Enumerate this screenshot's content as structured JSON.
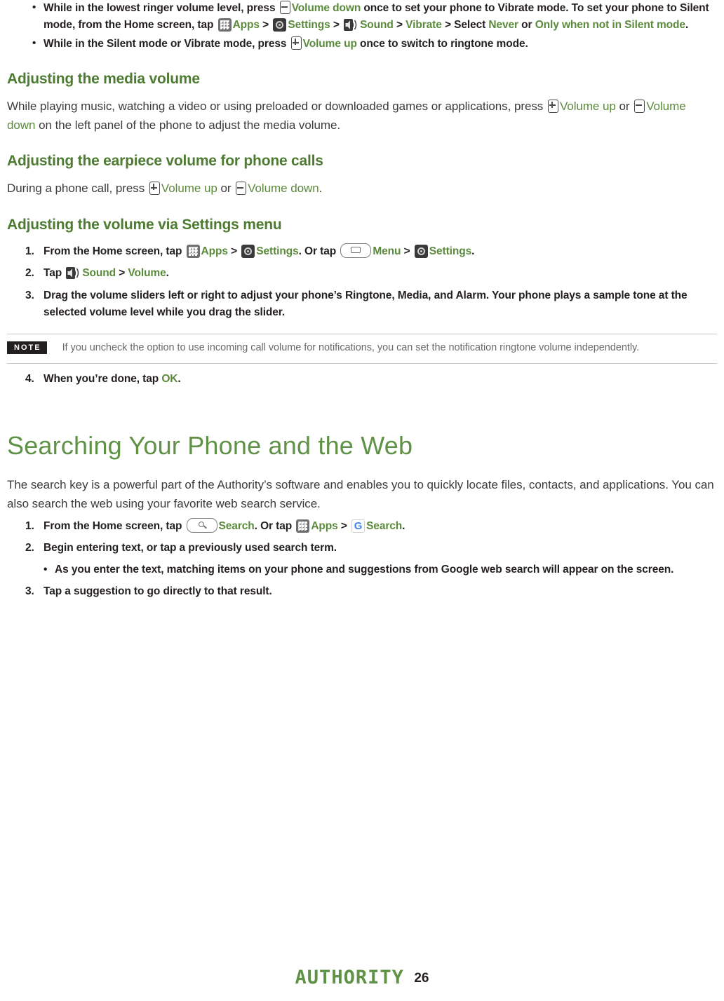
{
  "top_bullets": [
    {
      "parts": [
        {
          "t": "text",
          "v": "While in the lowest ringer volume level, press "
        },
        {
          "t": "icon",
          "v": "volume-down-key-icon"
        },
        {
          "t": "green",
          "v": "Volume down"
        },
        {
          "t": "text",
          "v": " once to set your phone to Vibrate mode. To set your phone to Silent mode, from the Home screen, tap "
        },
        {
          "t": "icon",
          "v": "apps-icon"
        },
        {
          "t": "green",
          "v": "Apps"
        },
        {
          "t": "text",
          "v": " > "
        },
        {
          "t": "icon",
          "v": "settings-icon"
        },
        {
          "t": "green",
          "v": "Settings"
        },
        {
          "t": "text",
          "v": " > "
        },
        {
          "t": "icon",
          "v": "sound-icon"
        },
        {
          "t": "green",
          "v": "Sound"
        },
        {
          "t": "text",
          "v": " > "
        },
        {
          "t": "green",
          "v": "Vibrate"
        },
        {
          "t": "text",
          "v": " > Select "
        },
        {
          "t": "green",
          "v": "Never"
        },
        {
          "t": "text",
          "v": " or "
        },
        {
          "t": "green",
          "v": "Only when not in Silent mode"
        },
        {
          "t": "text",
          "v": "."
        }
      ]
    },
    {
      "parts": [
        {
          "t": "text",
          "v": "While in the Silent mode or Vibrate mode, press "
        },
        {
          "t": "icon",
          "v": "volume-up-key-icon"
        },
        {
          "t": "green",
          "v": "Volume up"
        },
        {
          "t": "text",
          "v": " once to switch to ringtone mode."
        }
      ]
    }
  ],
  "media_volume": {
    "heading": "Adjusting the media volume",
    "parts": [
      {
        "t": "text",
        "v": "While playing music, watching a video or using preloaded or downloaded games or applications, press "
      },
      {
        "t": "icon",
        "v": "volume-up-key-icon"
      },
      {
        "t": "green",
        "v": "Volume up"
      },
      {
        "t": "text",
        "v": " or "
      },
      {
        "t": "icon",
        "v": "volume-down-key-icon"
      },
      {
        "t": "green",
        "v": "Volume down"
      },
      {
        "t": "text",
        "v": " on the left panel of the phone to adjust the media volume."
      }
    ]
  },
  "earpiece_volume": {
    "heading": "Adjusting the earpiece volume for phone calls",
    "parts": [
      {
        "t": "text",
        "v": "During a phone call, press "
      },
      {
        "t": "icon",
        "v": "volume-up-key-icon"
      },
      {
        "t": "green",
        "v": "Volume up"
      },
      {
        "t": "text",
        "v": " or "
      },
      {
        "t": "icon",
        "v": "volume-down-key-icon"
      },
      {
        "t": "green",
        "v": "Volume down"
      },
      {
        "t": "text",
        "v": "."
      }
    ]
  },
  "settings_volume": {
    "heading": "Adjusting the volume via Settings menu",
    "steps": [
      {
        "num": "1.",
        "parts": [
          {
            "t": "text",
            "v": "From the Home screen, tap "
          },
          {
            "t": "icon",
            "v": "apps-icon"
          },
          {
            "t": "green",
            "v": "Apps"
          },
          {
            "t": "text",
            "v": " > "
          },
          {
            "t": "icon",
            "v": "settings-icon"
          },
          {
            "t": "green",
            "v": "Settings"
          },
          {
            "t": "text",
            "v": ". Or tap "
          },
          {
            "t": "icon",
            "v": "menu-key-icon"
          },
          {
            "t": "green",
            "v": "Menu"
          },
          {
            "t": "text",
            "v": " > "
          },
          {
            "t": "icon",
            "v": "settings-icon"
          },
          {
            "t": "green",
            "v": "Settings"
          },
          {
            "t": "text",
            "v": "."
          }
        ]
      },
      {
        "num": "2.",
        "parts": [
          {
            "t": "text",
            "v": "Tap "
          },
          {
            "t": "icon",
            "v": "sound-icon"
          },
          {
            "t": "green",
            "v": "Sound"
          },
          {
            "t": "text",
            "v": " > "
          },
          {
            "t": "green",
            "v": "Volume"
          },
          {
            "t": "text",
            "v": "."
          }
        ]
      },
      {
        "num": "3.",
        "parts": [
          {
            "t": "text",
            "v": "Drag the volume sliders left or right to adjust your phone’s Ringtone, Media, and Alarm. Your phone plays a sample tone at the selected volume level while you drag the slider."
          }
        ]
      }
    ],
    "note": {
      "badge": "NOTE",
      "text": "If you uncheck the option to use incoming call volume for notifications, you can set the notification ringtone volume independently."
    },
    "final_step": {
      "num": "4.",
      "parts": [
        {
          "t": "text",
          "v": "When you’re done, tap "
        },
        {
          "t": "green",
          "v": "OK"
        },
        {
          "t": "text",
          "v": "."
        }
      ]
    }
  },
  "search_chapter": {
    "title": "Searching Your Phone and the Web",
    "intro": "The search key is a powerful part of the Authority’s software and enables you to quickly locate files, contacts, and applications. You can also search the web using your favorite web search service.",
    "steps": [
      {
        "num": "1.",
        "parts": [
          {
            "t": "text",
            "v": "From the Home screen, tap "
          },
          {
            "t": "icon",
            "v": "search-key-icon"
          },
          {
            "t": "green",
            "v": "Search"
          },
          {
            "t": "text",
            "v": ". Or tap "
          },
          {
            "t": "icon",
            "v": "apps-icon"
          },
          {
            "t": "green",
            "v": "Apps"
          },
          {
            "t": "text",
            "v": " > "
          },
          {
            "t": "icon",
            "v": "google-search-icon"
          },
          {
            "t": "green",
            "v": "Search"
          },
          {
            "t": "text",
            "v": "."
          }
        ]
      },
      {
        "num": "2.",
        "parts": [
          {
            "t": "text",
            "v": "Begin entering text, or tap a previously used search term."
          }
        ]
      }
    ],
    "substep": "As you enter the text, matching items on your phone and suggestions from Google web search will appear on the screen.",
    "last_step": {
      "num": "3.",
      "parts": [
        {
          "t": "text",
          "v": "Tap a suggestion to go directly to that result."
        }
      ]
    }
  },
  "footer": {
    "brand": "AUTHORITY",
    "page_number": "26"
  },
  "colors": {
    "green_accent": "#5b8a3c",
    "heading_green": "#4e7b32",
    "chapter_green": "#5f9246",
    "body_text": "#231f20",
    "note_text": "#6a6a6a"
  }
}
